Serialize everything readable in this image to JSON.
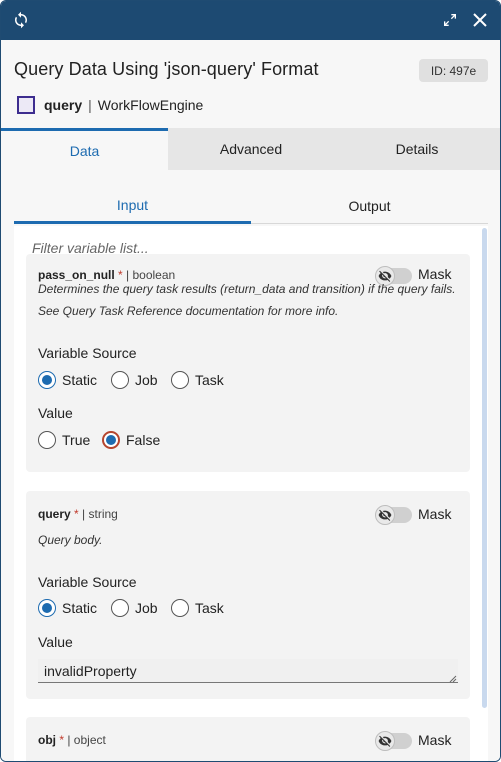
{
  "window": {
    "refresh_icon": "refresh-icon",
    "expand_icon": "expand-icon",
    "close_icon": "close-icon",
    "topbar_color": "#1d4a72"
  },
  "header": {
    "title": "Query Data Using 'json-query' Format",
    "id_badge": "ID: 497e",
    "task_name": "query",
    "separator": "|",
    "app_name": "WorkFlowEngine"
  },
  "tabs": [
    {
      "label": "Data",
      "active": true
    },
    {
      "label": "Advanced",
      "active": false
    },
    {
      "label": "Details",
      "active": false
    }
  ],
  "subtabs": [
    {
      "label": "Input",
      "active": true
    },
    {
      "label": "Output",
      "active": false
    }
  ],
  "filter": {
    "placeholder": "Filter variable list..."
  },
  "variables": [
    {
      "name": "pass_on_null",
      "required": "*",
      "type": "| boolean",
      "mask_label": "Mask",
      "description": "Determines the query task results (return_data and transition) if the query fails. See Query Task Reference documentation for more info.",
      "source_label": "Variable Source",
      "sources": [
        "Static",
        "Job",
        "Task"
      ],
      "selected_source": "Static",
      "value_label": "Value",
      "value_options": [
        "True",
        "False"
      ],
      "selected_value": "False"
    },
    {
      "name": "query",
      "required": "*",
      "type": "| string",
      "mask_label": "Mask",
      "description": "Query body.",
      "source_label": "Variable Source",
      "sources": [
        "Static",
        "Job",
        "Task"
      ],
      "selected_source": "Static",
      "value_label": "Value",
      "value": "invalidProperty"
    },
    {
      "name": "obj",
      "required": "*",
      "type": "| object",
      "mask_label": "Mask"
    }
  ],
  "colors": {
    "accent": "#1d6bb0",
    "required": "#c0392b",
    "panel_bg": "#f7f7f7"
  }
}
